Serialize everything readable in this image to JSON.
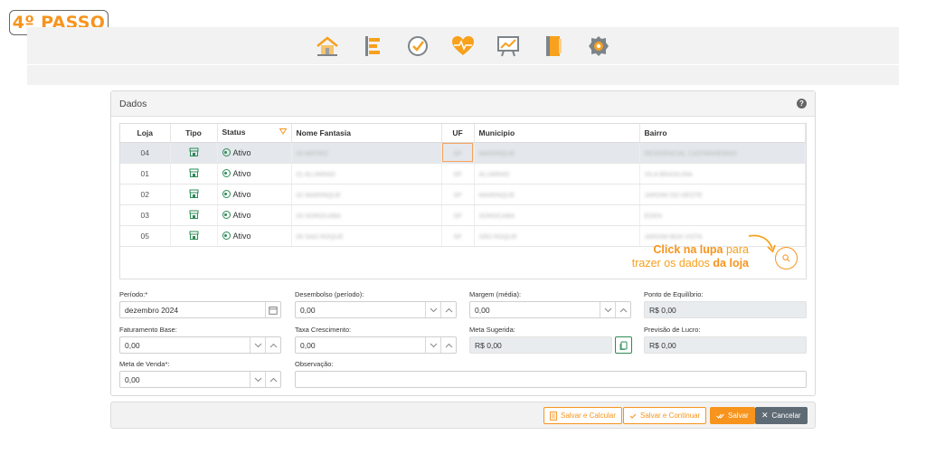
{
  "step": {
    "label": "4º PASSO"
  },
  "nav": {
    "items": [
      {
        "name": "home-icon"
      },
      {
        "name": "list-icon"
      },
      {
        "name": "check-clock-icon"
      },
      {
        "name": "heart-pulse-icon"
      },
      {
        "name": "chart-board-icon"
      },
      {
        "name": "book-icon"
      },
      {
        "name": "gear-icon"
      }
    ]
  },
  "panel": {
    "title": "Dados",
    "help": "?"
  },
  "table": {
    "headers": {
      "loja": "Loja",
      "tipo": "Tipo",
      "status": "Status",
      "nome": "Nome Fantasia",
      "uf": "UF",
      "municipio": "Municipio",
      "bairro": "Bairro"
    },
    "rows": [
      {
        "loja": "04",
        "status": "Ativo",
        "nome": "04 MATRIZ",
        "uf": "SP",
        "municipio": "MAIRINQUE",
        "bairro": "RESIDENCIAL CASTANHEIRAS"
      },
      {
        "loja": "01",
        "status": "Ativo",
        "nome": "01 ALUMINIO",
        "uf": "SP",
        "municipio": "ALUMINIO",
        "bairro": "VILA BRASILINA"
      },
      {
        "loja": "02",
        "status": "Ativo",
        "nome": "02 MAIRINQUE",
        "uf": "SP",
        "municipio": "MAIRINQUE",
        "bairro": "JARDIM DO OESTE"
      },
      {
        "loja": "03",
        "status": "Ativo",
        "nome": "03 SOROCABA",
        "uf": "SP",
        "municipio": "SOROCABA",
        "bairro": "EDEN"
      },
      {
        "loja": "05",
        "status": "Ativo",
        "nome": "05 SAO ROQUE",
        "uf": "SP",
        "municipio": "SÃO ROQUE",
        "bairro": "JARDIM BOA VISTA"
      }
    ]
  },
  "callout": {
    "part1": "Click na lupa",
    "part2": " para",
    "part3": "trazer os dados ",
    "part4": "da loja"
  },
  "form": {
    "periodo": {
      "label": "Período:*",
      "value": "dezembro 2024"
    },
    "desembolso": {
      "label": "Desembolso (período):",
      "value": "0,00"
    },
    "margem": {
      "label": "Margem (média):",
      "value": "0,00"
    },
    "ponto": {
      "label": "Ponto de Equilíbrio:",
      "value": "R$ 0,00"
    },
    "faturamento": {
      "label": "Faturamento Base:",
      "value": "0,00"
    },
    "taxa": {
      "label": "Taxa Crescimento:",
      "value": "0,00"
    },
    "meta_sugerida": {
      "label": "Meta Sugerida:",
      "value": "R$ 0,00"
    },
    "previsao": {
      "label": "Previsão de Lucro:",
      "value": "R$ 0,00"
    },
    "meta_venda": {
      "label": "Meta de Venda*:",
      "value": "0,00"
    },
    "observacao": {
      "label": "Observação:",
      "value": ""
    }
  },
  "footer": {
    "salvar_calcular": "Salvar e Calcular",
    "salvar_continuar": "Salvar e Continuar",
    "salvar": "Salvar",
    "cancelar": "Cancelar"
  },
  "colors": {
    "accent": "#f7941d",
    "green": "#2e8b57",
    "dark": "#5f6b74"
  }
}
